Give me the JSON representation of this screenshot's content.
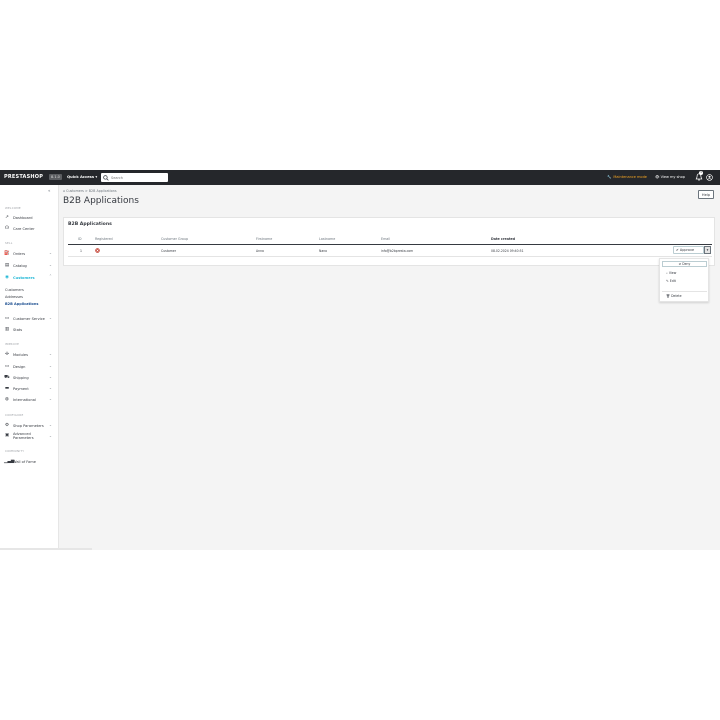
{
  "topbar": {
    "logo": "PRESTASHOP",
    "version": "8.1.0",
    "quick_access": "Quick Access",
    "search_placeholder": "Search",
    "maintenance": "Maintenance mode",
    "view_shop": "View my shop",
    "notification_count": "1"
  },
  "sidebar": {
    "welcome": "WELCOME",
    "dashboard": "Dashboard",
    "care_center": "Care Center",
    "sell": "SELL",
    "orders": "Orders",
    "catalog": "Catalog",
    "customers": "Customers",
    "sub_customers": "Customers",
    "sub_addresses": "Addresses",
    "sub_b2b": "B2B Applications",
    "customer_service": "Customer Service",
    "stats": "Stats",
    "improve": "IMPROVE",
    "modules": "Modules",
    "design": "Design",
    "shipping": "Shipping",
    "payment": "Payment",
    "international": "International",
    "configure": "CONFIGURE",
    "shop_parameters": "Shop Parameters",
    "advanced_params_1": "Advanced",
    "advanced_params_2": "Parameters",
    "community": "COMMUNITY",
    "wall_of_fame": "Wall of Fame"
  },
  "breadcrumb": {
    "parent": "Customers",
    "current": "B2B Applications"
  },
  "page_title": "B2B Applications",
  "help": "Help",
  "card": {
    "title": "B2B Applications",
    "columns": [
      "ID",
      "Registered",
      "Customer Group",
      "Firstname",
      "Lastname",
      "Email",
      "Date created"
    ],
    "row": {
      "id": "1",
      "group": "Customer",
      "firstname": "Anna",
      "lastname": "Nano",
      "email": "info@b2bpresta.com",
      "date": "08.02.2024 09:40:51"
    },
    "approve": "Approve"
  },
  "dropdown": {
    "deny": "Deny",
    "view": "View",
    "edit": "Edit",
    "delete": "Delete"
  }
}
